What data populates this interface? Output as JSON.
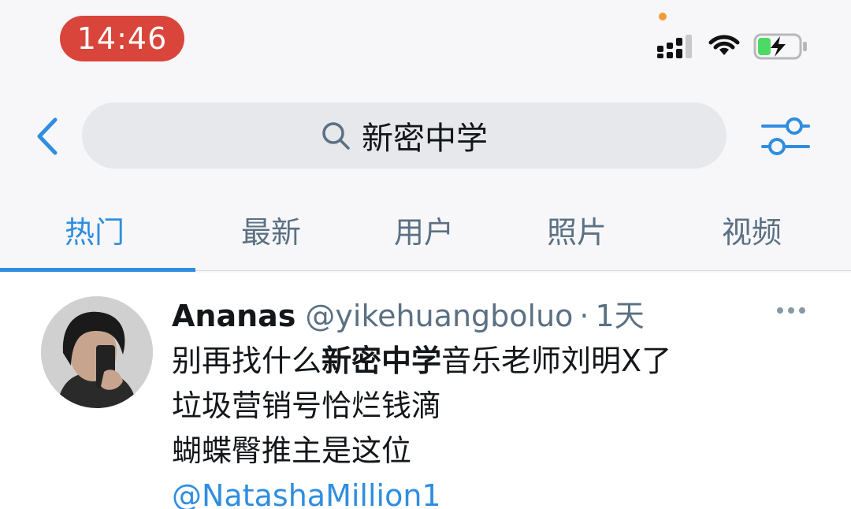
{
  "status_bar": {
    "time": "14:46",
    "icons": [
      "signal-icon",
      "wifi-icon",
      "battery-charging-icon"
    ],
    "indicator_color": "#f29a38"
  },
  "search": {
    "query": "新密中学",
    "icons": [
      "back-chevron-icon",
      "search-icon",
      "filter-sliders-icon"
    ]
  },
  "tabs": [
    {
      "label": "热门",
      "active": true
    },
    {
      "label": "最新",
      "active": false
    },
    {
      "label": "用户",
      "active": false
    },
    {
      "label": "照片",
      "active": false
    },
    {
      "label": "视频",
      "active": false
    }
  ],
  "tweet": {
    "display_name": "Ananas",
    "handle": "@yikehuangboluo",
    "separator": "·",
    "time_ago": "1天",
    "body": {
      "line1_before": "别再找什么",
      "line1_highlight": "新密中学",
      "line1_after": "音乐老师刘明X了",
      "line2": "垃圾营销号恰烂钱滴",
      "line3": "蝴蝶臀推主是这位",
      "mention": "@NatashaMillion1"
    }
  },
  "colors": {
    "accent": "#2f8ee0",
    "time_pill": "#d9453b",
    "secondary_text": "#5b7083",
    "search_bg": "#e6e8eb"
  }
}
